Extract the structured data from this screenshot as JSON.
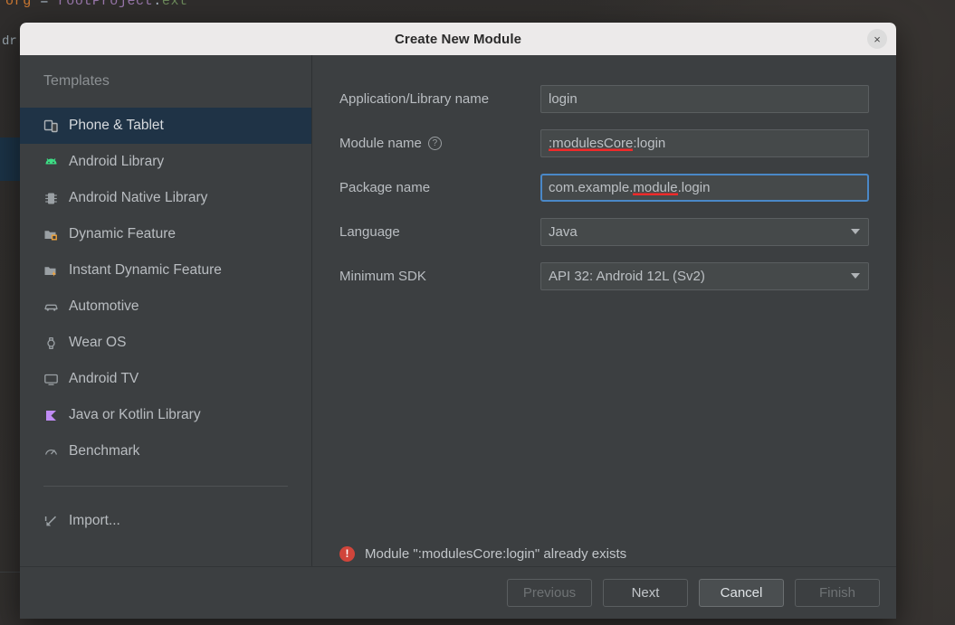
{
  "background": {
    "code_line": {
      "keyword": "org",
      "operator": "=",
      "identifier": "rootProject",
      "dot": ".",
      "property": "ext"
    },
    "side_text": "dr"
  },
  "dialog": {
    "title": "Create New Module",
    "close_icon": "close-icon",
    "close_label": "×"
  },
  "sidebar": {
    "header": "Templates",
    "items": [
      {
        "label": "Phone & Tablet",
        "icon": "phone-tablet-icon",
        "selected": true
      },
      {
        "label": "Android Library",
        "icon": "android-robot-icon",
        "selected": false
      },
      {
        "label": "Android Native Library",
        "icon": "native-chip-icon",
        "selected": false
      },
      {
        "label": "Dynamic Feature",
        "icon": "dynamic-feature-folder-icon",
        "selected": false
      },
      {
        "label": "Instant Dynamic Feature",
        "icon": "instant-feature-folder-icon",
        "selected": false
      },
      {
        "label": "Automotive",
        "icon": "car-icon",
        "selected": false
      },
      {
        "label": "Wear OS",
        "icon": "watch-icon",
        "selected": false
      },
      {
        "label": "Android TV",
        "icon": "tv-monitor-icon",
        "selected": false
      },
      {
        "label": "Java or Kotlin Library",
        "icon": "kotlin-logo-icon",
        "selected": false
      },
      {
        "label": "Benchmark",
        "icon": "benchmark-gauge-icon",
        "selected": false
      }
    ],
    "import": {
      "label": "Import...",
      "icon": "import-arrow-icon"
    }
  },
  "form": {
    "app_name": {
      "label": "Application/Library name",
      "value": "login"
    },
    "module_name": {
      "label": "Module name",
      "help_icon": "help-circle-icon",
      "help_glyph": "?",
      "value_error_part": ":modulesCore",
      "value_rest": ":login"
    },
    "package_name": {
      "label": "Package name",
      "value_prefix": "com.example.",
      "value_error_part": "module",
      "value_suffix": ".login",
      "focused": true
    },
    "language": {
      "label": "Language",
      "value": "Java"
    },
    "min_sdk": {
      "label": "Minimum SDK",
      "value": "API 32: Android 12L (Sv2)"
    }
  },
  "error": {
    "icon": "error-circle-icon",
    "glyph": "!",
    "message": "Module \":modulesCore:login\" already exists"
  },
  "footer": {
    "buttons": [
      {
        "label": "Previous",
        "state": "disabled"
      },
      {
        "label": "Next",
        "state": "enabled"
      },
      {
        "label": "Cancel",
        "state": "default"
      },
      {
        "label": "Finish",
        "state": "disabled"
      }
    ]
  },
  "colors": {
    "dialog_bg": "#3c3f41",
    "titlebar_bg": "#eceaea",
    "selection_blue": "#1f3346",
    "focus_blue": "#4a88c7",
    "error_red": "#d0453b",
    "underline_red": "#ef2a2a",
    "field_bg": "#45494a",
    "text": "#b9bdc1"
  }
}
